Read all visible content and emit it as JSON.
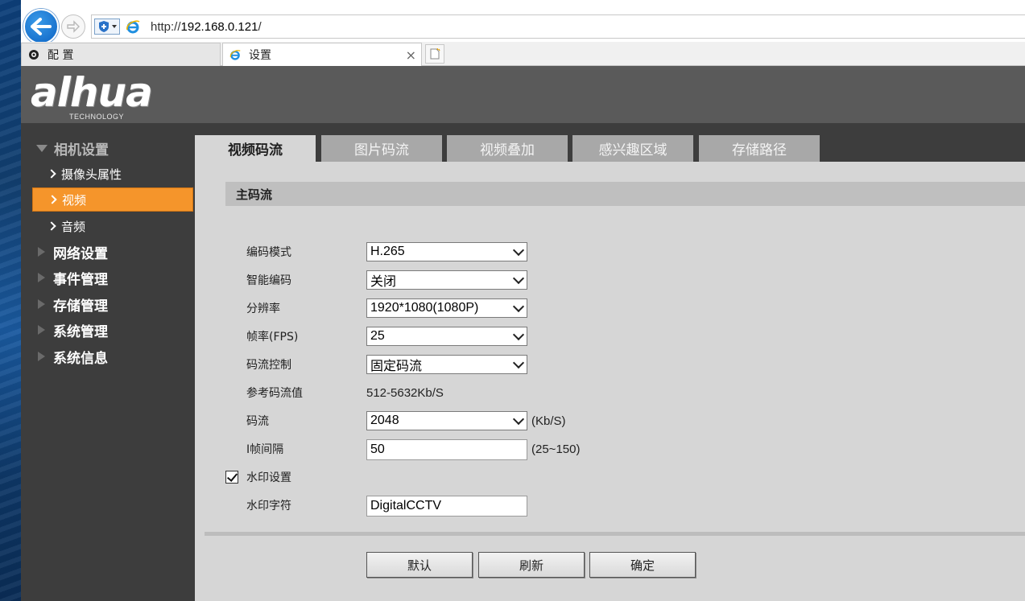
{
  "browser": {
    "url_prefix": "http://",
    "url_host": "192.168.0.121",
    "url_suffix": "/",
    "tabs": [
      {
        "label": "配 置"
      },
      {
        "label": "设置"
      }
    ],
    "close_glyph": "×"
  },
  "brand": {
    "logo_text": "alhua",
    "tagline": "TECHNOLOGY"
  },
  "sidebar": {
    "sections": [
      {
        "label": "相机设置",
        "expanded": true
      },
      {
        "label": "网络设置"
      },
      {
        "label": "事件管理"
      },
      {
        "label": "存储管理"
      },
      {
        "label": "系统管理"
      },
      {
        "label": "系统信息"
      }
    ],
    "camera_sub": [
      {
        "label": "摄像头属性"
      },
      {
        "label": "视频",
        "active": true
      },
      {
        "label": "音频"
      }
    ]
  },
  "tabs": [
    {
      "label": "视频码流",
      "active": true
    },
    {
      "label": "图片码流"
    },
    {
      "label": "视频叠加"
    },
    {
      "label": "感兴趣区域"
    },
    {
      "label": "存储路径"
    }
  ],
  "section_title": "主码流",
  "form": {
    "encode_mode": {
      "label": "编码模式",
      "value": "H.265"
    },
    "smart_codec": {
      "label": "智能编码",
      "value": "关闭"
    },
    "resolution": {
      "label": "分辨率",
      "value": "1920*1080(1080P)"
    },
    "frame_rate": {
      "label": "帧率(FPS)",
      "value": "25"
    },
    "bitrate_control": {
      "label": "码流控制",
      "value": "固定码流"
    },
    "reference_bitrate": {
      "label": "参考码流值",
      "value": "512-5632Kb/S"
    },
    "bitrate": {
      "label": "码流",
      "value": "2048",
      "unit": "(Kb/S)"
    },
    "i_frame_interval": {
      "label": "I帧间隔",
      "value": "50",
      "range": "(25~150)"
    },
    "watermark": {
      "label": "水印设置",
      "checked": true
    },
    "watermark_text": {
      "label": "水印字符",
      "value": "DigitalCCTV"
    }
  },
  "buttons": {
    "default": "默认",
    "refresh": "刷新",
    "ok": "确定"
  },
  "colors": {
    "accent": "#f5952b",
    "header_bg": "#5a5a5a",
    "sidebar_bg": "#3d3d3d",
    "content_bg": "#d6d6d6"
  }
}
